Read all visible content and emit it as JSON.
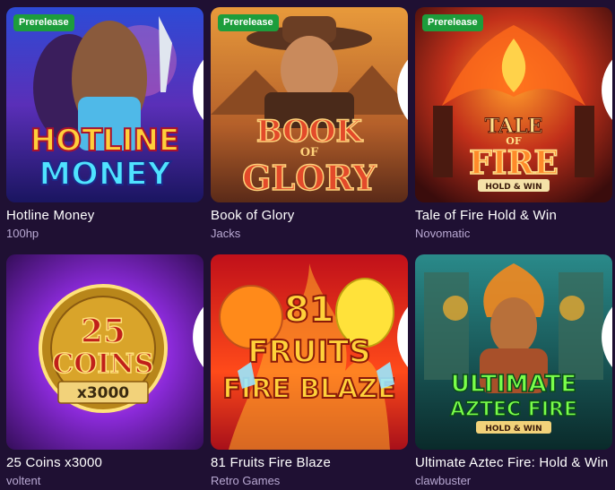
{
  "games": [
    {
      "title": "Hotline Money",
      "provider": "100hp",
      "badge": "Prerelease",
      "favorite_icon": "heart-outline-icon"
    },
    {
      "title": "Book of Glory",
      "provider": "Jacks",
      "badge": "Prerelease",
      "favorite_icon": "heart-outline-icon"
    },
    {
      "title": "Tale of Fire Hold & Win",
      "provider": "Novomatic",
      "badge": "Prerelease",
      "favorite_icon": "heart-outline-icon"
    },
    {
      "title": "25 Coins x3000",
      "provider": "voltent",
      "badge": "",
      "favorite_icon": "heart-outline-icon"
    },
    {
      "title": "81 Fruits Fire Blaze",
      "provider": "Retro Games",
      "badge": "",
      "favorite_icon": "heart-outline-icon"
    },
    {
      "title": "Ultimate Aztec Fire: Hold & Win",
      "provider": "clawbuster",
      "badge": "",
      "favorite_icon": "heart-outline-icon"
    }
  ],
  "art": {
    "hotline": {
      "line1": "HOTLINE",
      "line2": "MONEY"
    },
    "glory": {
      "line1": "BOOK",
      "line2": "OF",
      "line3": "GLORY"
    },
    "fire": {
      "line1": "TALE",
      "line2": "OF",
      "line3": "FIRE",
      "line4": "HOLD & WIN"
    },
    "coins": {
      "line1": "25",
      "line2": "COINS",
      "line3": "x3000"
    },
    "fruits": {
      "line1": "81",
      "line2": "FRUITS",
      "line3": "FIRE BLAZE"
    },
    "aztec": {
      "line1": "ULTIMATE",
      "line2": "AZTEC FIRE",
      "line3": "HOLD & WIN"
    }
  },
  "colors": {
    "background": "#1f1033",
    "badge": "#1d9d3c",
    "title": "#ffffff",
    "provider": "#b9a9d3"
  }
}
